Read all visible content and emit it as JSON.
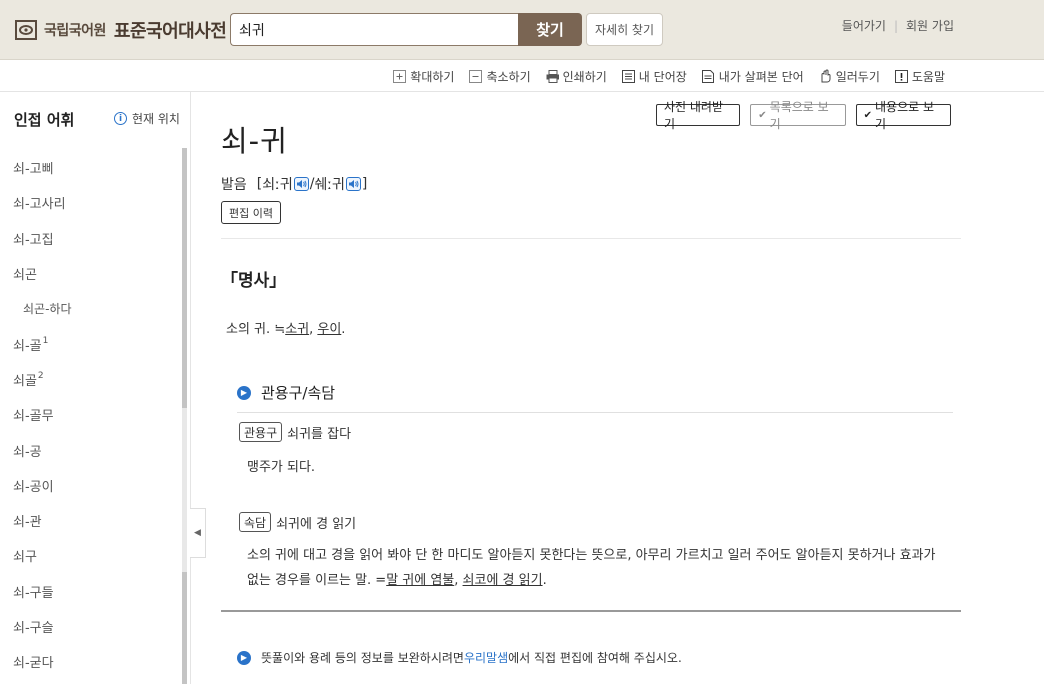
{
  "header": {
    "logo_institute": "국립국어원",
    "logo_title": "표준국어대사전",
    "search_value": "쇠귀",
    "search_button": "찾기",
    "detail_button": "자세히 찾기",
    "login": "들어가기",
    "signup": "회원 가입"
  },
  "toolbar": {
    "items": [
      "확대하기",
      "축소하기",
      "인쇄하기",
      "내 단어장",
      "내가 살펴본 단어",
      "일러두기",
      "도움말"
    ]
  },
  "sidebar": {
    "title": "인접 어휘",
    "location": "현재 위치",
    "items": [
      {
        "label": "쇠-고삐",
        "sup": ""
      },
      {
        "label": "쇠-고사리",
        "sup": ""
      },
      {
        "label": "쇠-고집",
        "sup": ""
      },
      {
        "label": "쇠곤",
        "sup": ""
      },
      {
        "label": "쇠곤-하다",
        "sup": ""
      },
      {
        "label": "쇠-골",
        "sup": "1"
      },
      {
        "label": "쇠골",
        "sup": "2"
      },
      {
        "label": "쇠-골무",
        "sup": ""
      },
      {
        "label": "쇠-공",
        "sup": ""
      },
      {
        "label": "쇠-공이",
        "sup": ""
      },
      {
        "label": "쇠-관",
        "sup": ""
      },
      {
        "label": "쇠구",
        "sup": ""
      },
      {
        "label": "쇠-구들",
        "sup": ""
      },
      {
        "label": "쇠-구슬",
        "sup": ""
      },
      {
        "label": "쇠-굳다",
        "sup": ""
      }
    ]
  },
  "entry": {
    "buttons": {
      "download": "사전 내려받기",
      "list_view": "목록으로 보기",
      "content_view": "내용으로 보기"
    },
    "headword": "쇠-귀",
    "pron_label": "발음",
    "pron_open": "[",
    "pron_1": "쇠ː귀",
    "pron_sep": "/",
    "pron_2": "쉐ː귀",
    "pron_close": "]",
    "edit_history": "편집 이력",
    "pos": "「명사」",
    "definition_text": "소의 귀. ≒",
    "definition_link1": "소귀",
    "definition_comma": ", ",
    "definition_link2": "우이",
    "definition_end": ".",
    "section_title": "관용구/속담",
    "idiom_tag": "관용구",
    "idiom": "쇠귀를 잡다",
    "idiom_def": "맹주가 되다.",
    "proverb_tag": "속담",
    "proverb": "쇠귀에 경 읽기",
    "proverb_def": "소의 귀에 대고 경을 읽어 봐야 단 한 마디도 알아듣지 못한다는 뜻으로, 아무리 가르치고 일러 주어도 알아듣지 못하거나 효과가 없는 경우를 이르는 말. =",
    "proverb_link1": "말 귀에 염불",
    "proverb_comma": ", ",
    "proverb_link2": "쇠코에 경 읽기",
    "proverb_end": ".",
    "notice_pre": "뜻풀이와 용례 등의 정보를 보완하시려면 ",
    "notice_link": "우리말샘",
    "notice_post": "에서 직접 편집에 참여해 주십시오."
  },
  "colors": {
    "header_bg": "#ebe8df",
    "search_button": "#7a6553",
    "accent_blue": "#2a73c9"
  }
}
